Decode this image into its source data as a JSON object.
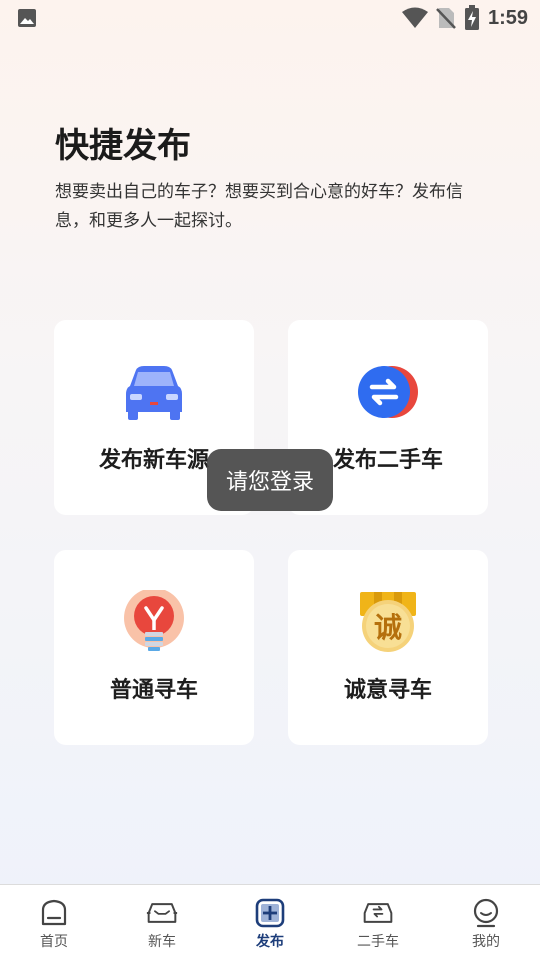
{
  "status_bar": {
    "time": "1:59",
    "icons": [
      "gallery-icon",
      "wifi-icon",
      "no-sim-icon",
      "battery-charging-icon"
    ]
  },
  "header": {
    "title": "快捷发布",
    "description": "想要卖出自己的车子？想要买到合心意的好车？发布信息，和更多人一起探讨。"
  },
  "cards": [
    {
      "label": "发布新车源",
      "icon": "car-icon"
    },
    {
      "label": "发布二手车",
      "icon": "exchange-icon"
    },
    {
      "label": "普通寻车",
      "icon": "lightbulb-icon"
    },
    {
      "label": "诚意寻车",
      "icon": "sincere-badge-icon",
      "icon_text": "诚"
    }
  ],
  "toast": {
    "text": "请您登录"
  },
  "bottom_nav": {
    "items": [
      {
        "label": "首页",
        "icon": "home-icon",
        "active": false
      },
      {
        "label": "新车",
        "icon": "new-car-icon",
        "active": false
      },
      {
        "label": "发布",
        "icon": "publish-plus-icon",
        "active": true
      },
      {
        "label": "二手车",
        "icon": "used-car-icon",
        "active": false
      },
      {
        "label": "我的",
        "icon": "profile-icon",
        "active": false
      }
    ]
  },
  "colors": {
    "accent": "#1d3d7a",
    "car_blue": "#4e74f2",
    "exchange_blue": "#2f6cf0",
    "exchange_red": "#e8473d",
    "bulb_red": "#e8473d",
    "badge_gold": "#f0b418"
  }
}
